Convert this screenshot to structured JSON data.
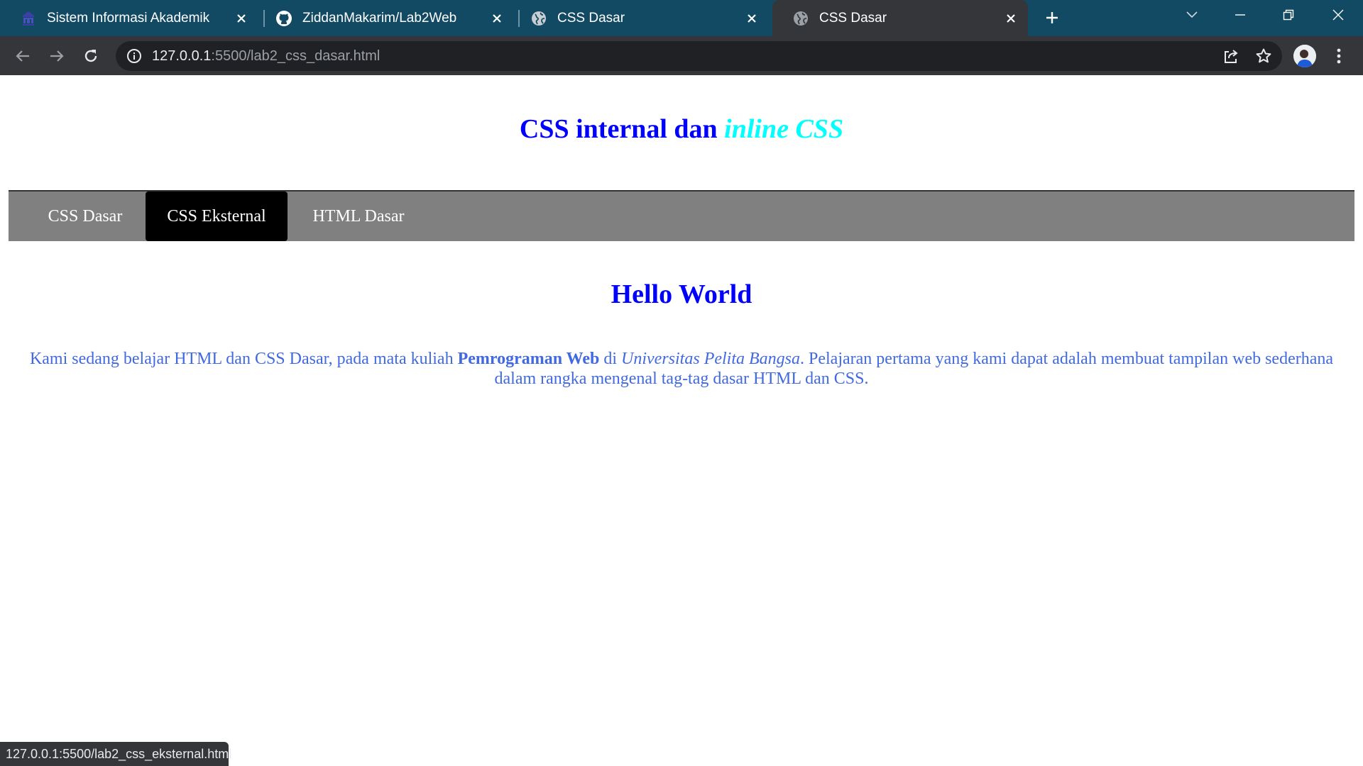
{
  "browser": {
    "tabs": [
      {
        "label": "Sistem Informasi Akademik",
        "icon": "university-icon",
        "active": false
      },
      {
        "label": "ZiddanMakarim/Lab2Web",
        "icon": "github-icon",
        "active": false
      },
      {
        "label": "CSS Dasar",
        "icon": "globe-icon",
        "active": false
      },
      {
        "label": "CSS Dasar",
        "icon": "globe-icon",
        "active": true
      }
    ],
    "url_host": "127.0.0.1",
    "url_rest": ":5500/lab2_css_dasar.html",
    "status_url": "127.0.0.1:5500/lab2_css_eksternal.html",
    "colors": {
      "tabstrip": "#124a63",
      "toolbar": "#35363a",
      "omnibox": "#202124"
    }
  },
  "page": {
    "title_plain": "CSS internal dan",
    "title_accent": "inline CSS",
    "nav": [
      {
        "label": "CSS Dasar",
        "active": false
      },
      {
        "label": "CSS Eksternal",
        "active": true
      },
      {
        "label": "HTML Dasar",
        "active": false
      }
    ],
    "heading": "Hello World",
    "paragraph": {
      "part1": "Kami sedang belajar HTML dan CSS Dasar, pada mata kuliah ",
      "bold": "Pemrograman Web",
      "part2": " di ",
      "italic": "Universitas Pelita Bangsa",
      "part3": ". Pelajaran pertama yang kami dapat adalah membuat tampilan web sederhana dalam rangka mengenal tag-tag dasar HTML dan CSS."
    },
    "colors": {
      "title": "#0000ff",
      "accent": "#00ffff",
      "navbar": "#808080",
      "nav_active": "#000000",
      "paragraph": "#4169e1"
    }
  }
}
